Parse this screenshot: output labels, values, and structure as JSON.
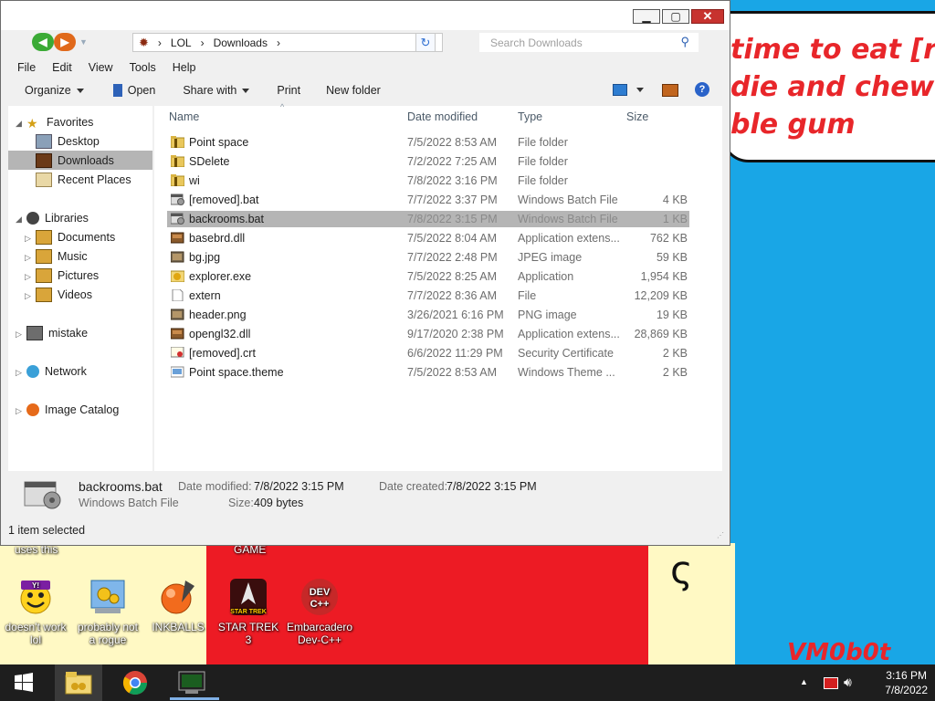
{
  "wallpaper": {
    "sign_text": "time to eat [removed]\ndie and chew\nble gum",
    "signature": "VM0b0t",
    "ink_glyph": "ς"
  },
  "desktop": {
    "top_captions": [
      "uses this",
      "GAME"
    ],
    "icons": [
      {
        "label": "doesn't work lol",
        "icon": "yahoo-icon",
        "color": "#7b1fa2"
      },
      {
        "label": "probably not a rogue",
        "icon": "gear-app-icon",
        "color": "#3c8dde"
      },
      {
        "label": "INKBALLS",
        "icon": "inkball-icon",
        "color": "#f26b1d"
      },
      {
        "label": "STAR TREK 3",
        "icon": "star-trek-icon",
        "color": "#b71c1c"
      },
      {
        "label": "Embarcadero Dev-C++",
        "icon": "devcpp-icon",
        "color": "#c62828",
        "badge": "DEV C++"
      }
    ]
  },
  "window": {
    "buttons": {
      "minimize": "▁",
      "maximize": "▢",
      "close": "✕"
    },
    "nav": {
      "back_icon": "back-arrow-icon",
      "forward_icon": "forward-arrow-icon",
      "recent_icon": "recent-pages-icon"
    },
    "address": {
      "sep": "›",
      "segments": [
        "LOL",
        "Downloads"
      ]
    },
    "search": {
      "placeholder": "Search Downloads"
    },
    "menu": [
      "File",
      "Edit",
      "View",
      "Tools",
      "Help"
    ],
    "toolbar": {
      "organize": "Organize",
      "open": "Open",
      "share_with": "Share with",
      "print": "Print",
      "new_folder": "New folder"
    },
    "nav_pane": {
      "favorites": "Favorites",
      "favorites_items": [
        "Desktop",
        "Downloads",
        "Recent Places"
      ],
      "libraries": "Libraries",
      "libraries_items": [
        "Documents",
        "Music",
        "Pictures",
        "Videos"
      ],
      "others": [
        "mistake",
        "Network",
        "Image Catalog"
      ]
    },
    "columns": {
      "name": "Name",
      "date": "Date modified",
      "type": "Type",
      "size": "Size"
    },
    "files": [
      {
        "name": "Point space",
        "date": "7/5/2022 8:53 AM",
        "type": "File folder",
        "size": "",
        "icon": "folder-icon"
      },
      {
        "name": "SDelete",
        "date": "7/2/2022 7:25 AM",
        "type": "File folder",
        "size": "",
        "icon": "folder-icon"
      },
      {
        "name": "wi",
        "date": "7/8/2022 3:16 PM",
        "type": "File folder",
        "size": "",
        "icon": "folder-icon"
      },
      {
        "name": "[removed].bat",
        "date": "7/7/2022 3:37 PM",
        "type": "Windows Batch File",
        "size": "4 KB",
        "icon": "batch-file-icon"
      },
      {
        "name": "backrooms.bat",
        "date": "7/8/2022 3:15 PM",
        "type": "Windows Batch File",
        "size": "1 KB",
        "icon": "batch-file-icon"
      },
      {
        "name": "basebrd.dll",
        "date": "7/5/2022 8:04 AM",
        "type": "Application extens...",
        "size": "762 KB",
        "icon": "dll-file-icon"
      },
      {
        "name": "bg.jpg",
        "date": "7/7/2022 2:48 PM",
        "type": "JPEG image",
        "size": "59 KB",
        "icon": "image-file-icon"
      },
      {
        "name": "explorer.exe",
        "date": "7/5/2022 8:25 AM",
        "type": "Application",
        "size": "1,954 KB",
        "icon": "explorer-app-icon"
      },
      {
        "name": "extern",
        "date": "7/7/2022 8:36 AM",
        "type": "File",
        "size": "12,209 KB",
        "icon": "blank-file-icon"
      },
      {
        "name": "header.png",
        "date": "3/26/2021 6:16 PM",
        "type": "PNG image",
        "size": "19 KB",
        "icon": "image-file-icon"
      },
      {
        "name": "opengl32.dll",
        "date": "9/17/2020 2:38 PM",
        "type": "Application extens...",
        "size": "28,869 KB",
        "icon": "dll-file-icon"
      },
      {
        "name": "[removed].crt",
        "date": "6/6/2022 11:29 PM",
        "type": "Security Certificate",
        "size": "2 KB",
        "icon": "certificate-icon"
      },
      {
        "name": "Point space.theme",
        "date": "7/5/2022 8:53 AM",
        "type": "Windows Theme ...",
        "size": "2 KB",
        "icon": "theme-file-icon"
      }
    ],
    "selected_index": 4,
    "details": {
      "name": "backrooms.bat",
      "type": "Windows Batch File",
      "date_modified_label": "Date modified:",
      "date_modified": "7/8/2022 3:15 PM",
      "date_created_label": "Date created:",
      "date_created": "7/8/2022 3:15 PM",
      "size_label": "Size:",
      "size": "409 bytes"
    },
    "status": "1 item selected"
  },
  "taskbar": {
    "time": "3:16 PM",
    "date": "7/8/2022",
    "apps": [
      "start-icon",
      "file-explorer-icon",
      "chrome-icon",
      "terminal-app-icon"
    ]
  }
}
